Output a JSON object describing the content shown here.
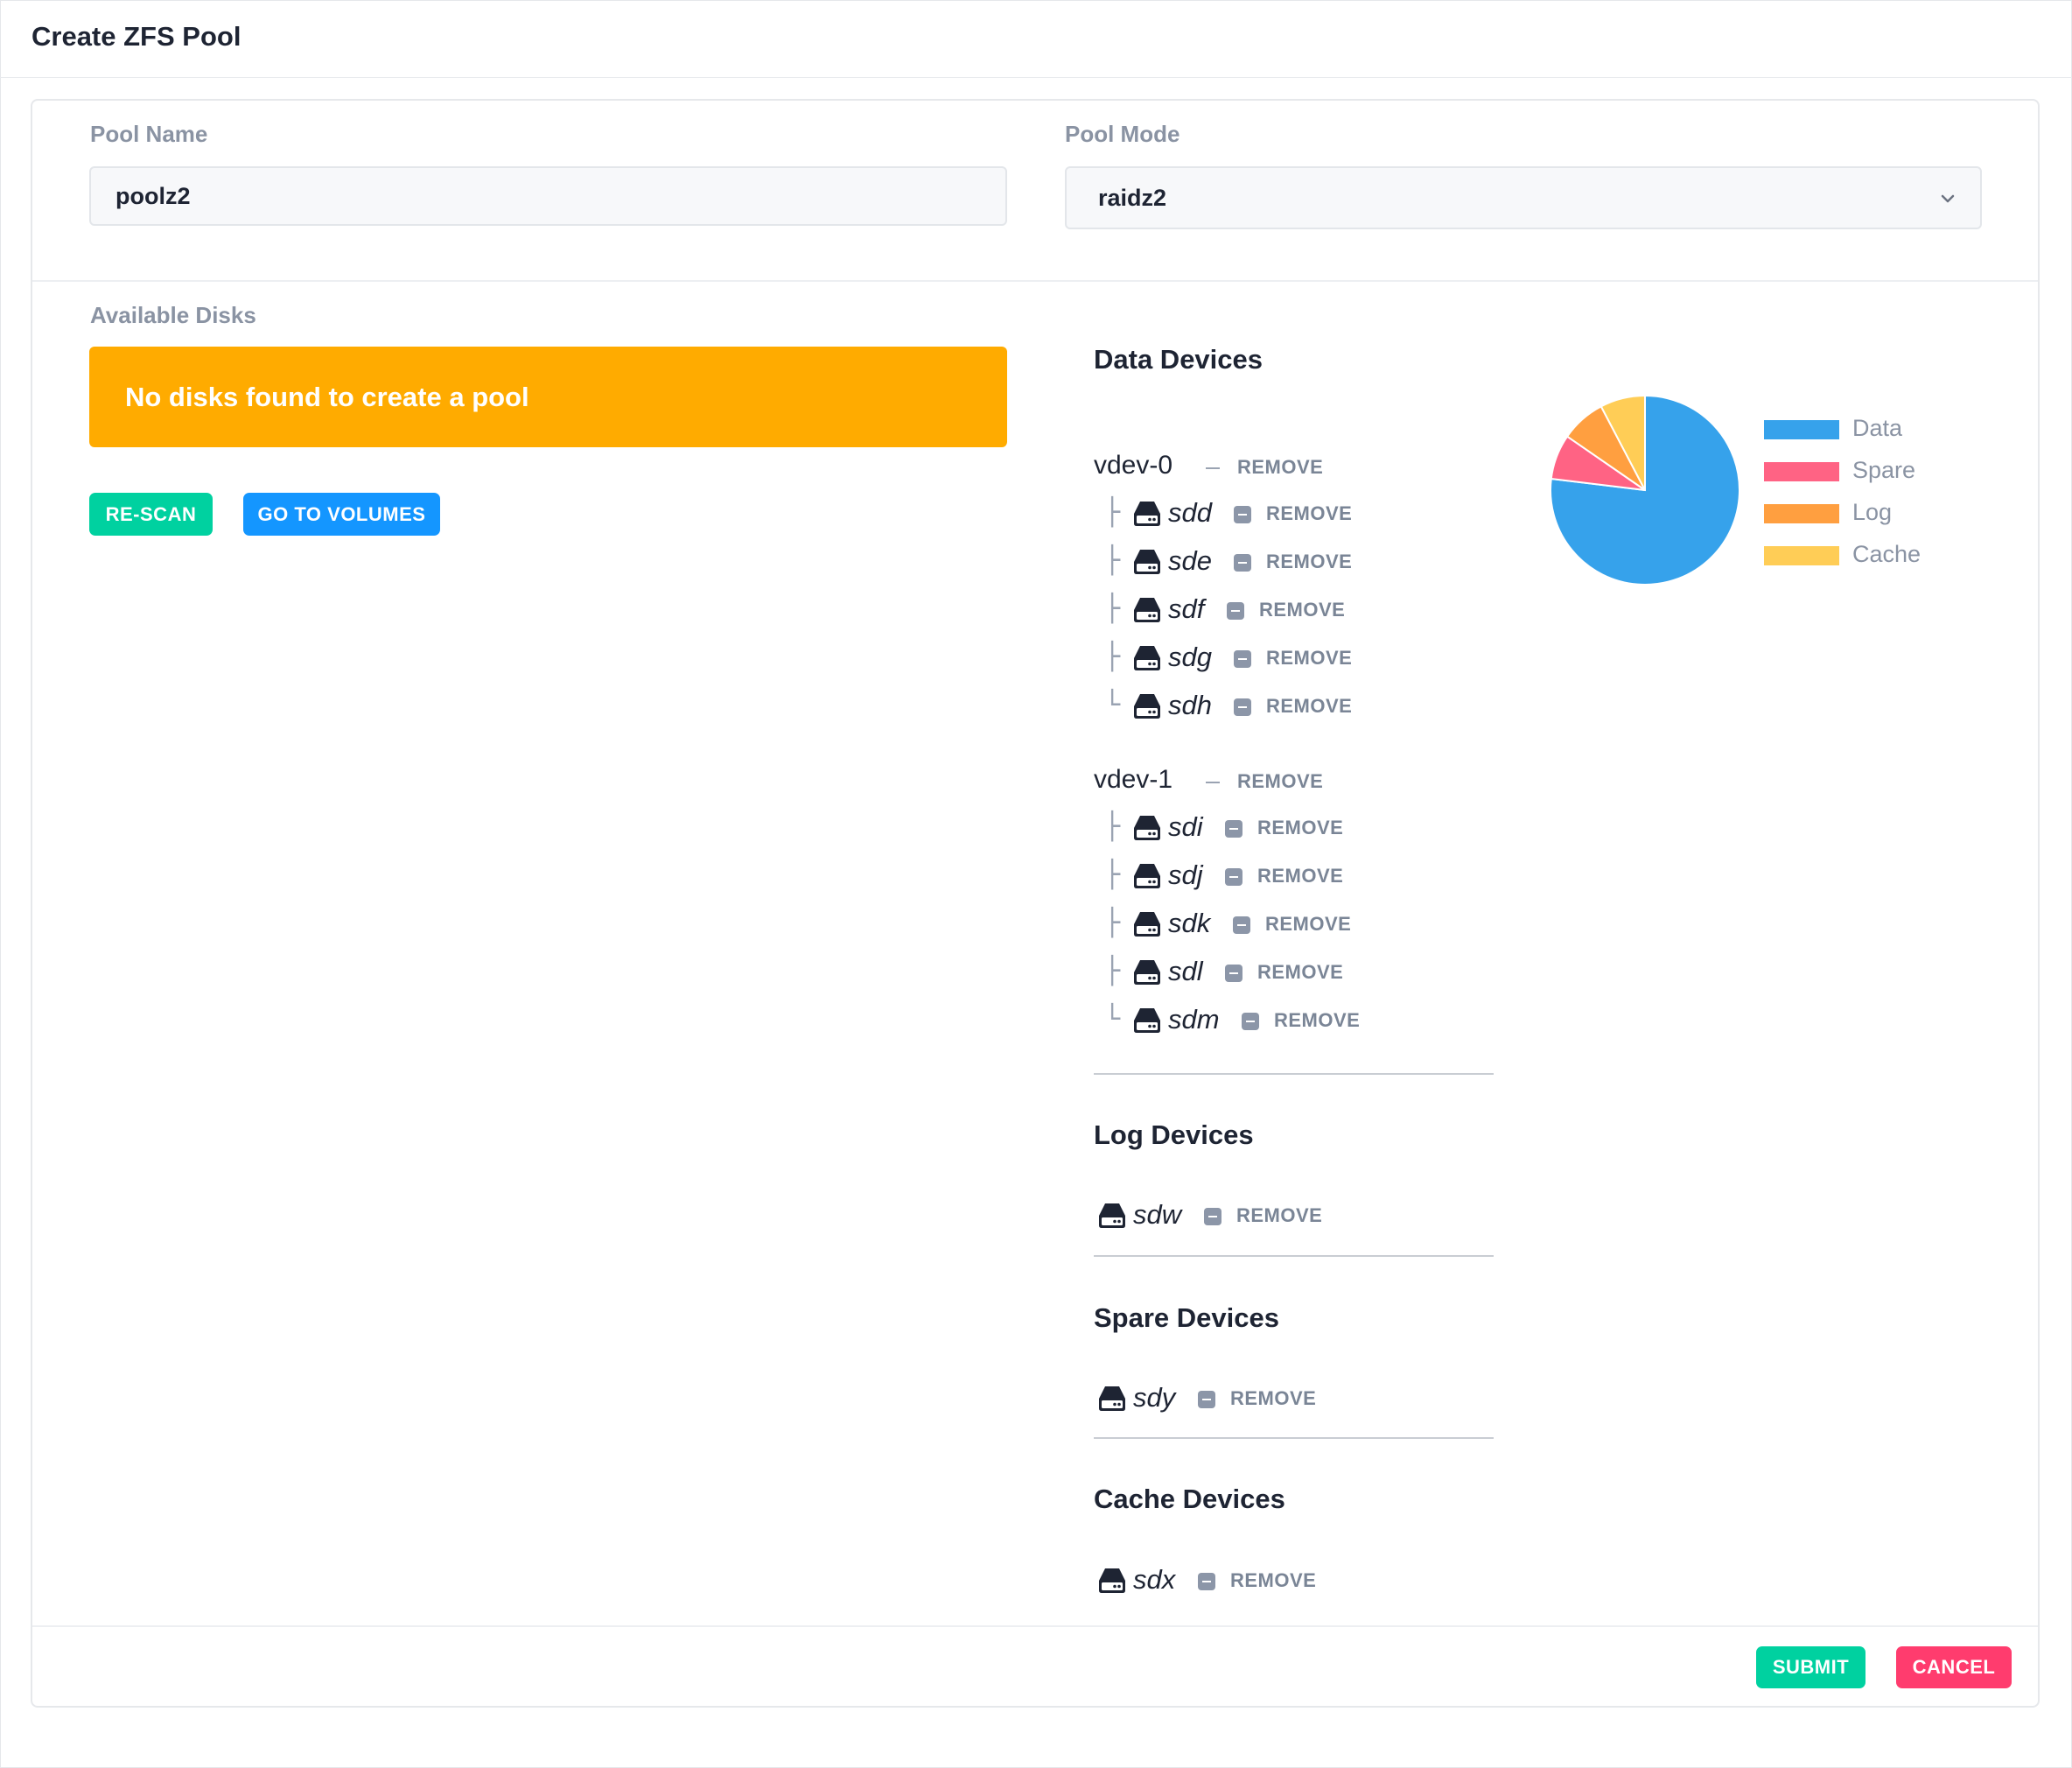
{
  "window": {
    "title": "Create ZFS Pool"
  },
  "form": {
    "pool_name_label": "Pool Name",
    "pool_name_value": "poolz2",
    "pool_mode_label": "Pool Mode",
    "pool_mode_value": "raidz2"
  },
  "available_disks": {
    "label": "Available Disks",
    "alert": "No disks found to create a pool",
    "rescan_label": "RE-SCAN",
    "go_to_volumes_label": "GO TO VOLUMES"
  },
  "data_devices": {
    "title": "Data Devices",
    "vdevs": [
      {
        "name": "vdev-0",
        "remove_label": "REMOVE",
        "disks": [
          {
            "tree": "├",
            "name": "sdd",
            "remove_label": "REMOVE"
          },
          {
            "tree": "├",
            "name": "sde",
            "remove_label": "REMOVE"
          },
          {
            "tree": "├",
            "name": "sdf",
            "remove_label": "REMOVE"
          },
          {
            "tree": "├",
            "name": "sdg",
            "remove_label": "REMOVE"
          },
          {
            "tree": "└",
            "name": "sdh",
            "remove_label": "REMOVE"
          }
        ]
      },
      {
        "name": "vdev-1",
        "remove_label": "REMOVE",
        "disks": [
          {
            "tree": "├",
            "name": "sdi",
            "remove_label": "REMOVE"
          },
          {
            "tree": "├",
            "name": "sdj",
            "remove_label": "REMOVE"
          },
          {
            "tree": "├",
            "name": "sdk",
            "remove_label": "REMOVE"
          },
          {
            "tree": "├",
            "name": "sdl",
            "remove_label": "REMOVE"
          },
          {
            "tree": "└",
            "name": "sdm",
            "remove_label": "REMOVE"
          }
        ]
      }
    ]
  },
  "log_devices": {
    "title": "Log Devices",
    "disks": [
      {
        "name": "sdw",
        "remove_label": "REMOVE"
      }
    ]
  },
  "spare_devices": {
    "title": "Spare Devices",
    "disks": [
      {
        "name": "sdy",
        "remove_label": "REMOVE"
      }
    ]
  },
  "cache_devices": {
    "title": "Cache Devices",
    "disks": [
      {
        "name": "sdx",
        "remove_label": "REMOVE"
      }
    ]
  },
  "chart_data": {
    "type": "pie",
    "categories": [
      "Data",
      "Spare",
      "Log",
      "Cache"
    ],
    "values": [
      10,
      1,
      1,
      1
    ],
    "colors": [
      "#36a2eb",
      "#ff6384",
      "#ff9f40",
      "#ffcd56"
    ],
    "legend_position": "right"
  },
  "footer": {
    "submit_label": "SUBMIT",
    "cancel_label": "CANCEL"
  },
  "colors": {
    "alert_warning": "#ffab00",
    "success": "#00d1a0",
    "info": "#1496ff",
    "danger": "#ff3c6e"
  },
  "icons": {
    "disk": "hard-drive-icon",
    "chevron": "chevron-down-icon",
    "remove": "minus-square-icon"
  }
}
